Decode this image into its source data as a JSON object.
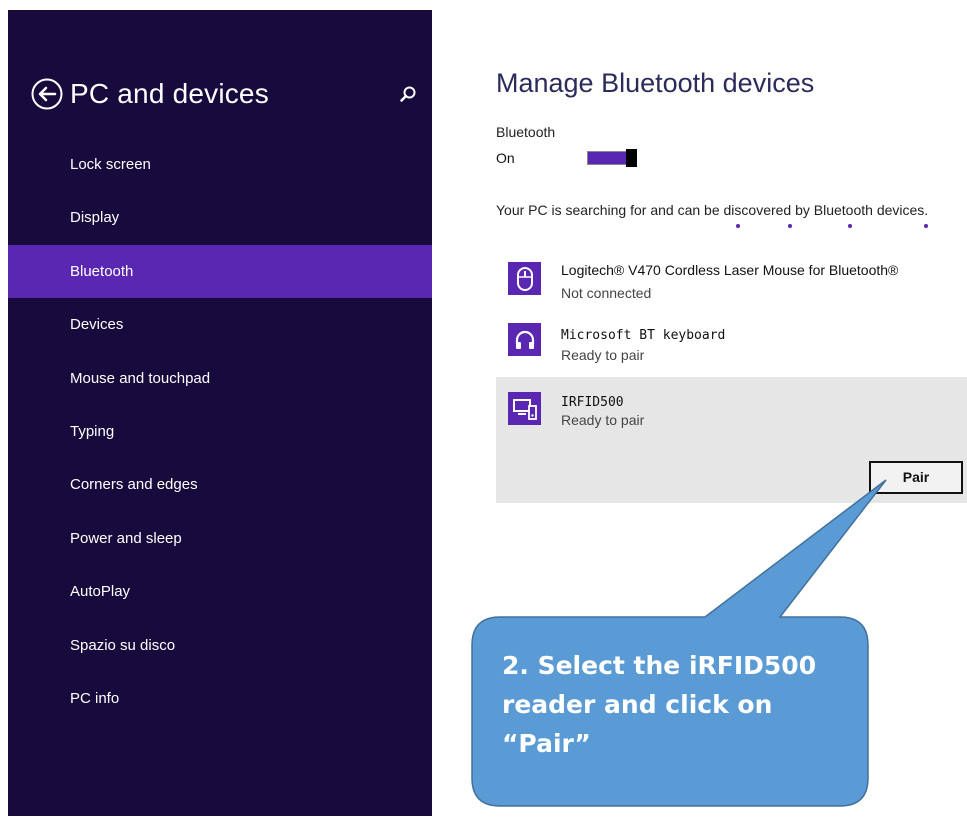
{
  "sidebar": {
    "title": "PC and devices",
    "back_icon": "back-arrow-circle-icon",
    "search_icon": "search-icon",
    "items": [
      {
        "label": "Lock screen",
        "active": false
      },
      {
        "label": "Display",
        "active": false
      },
      {
        "label": "Bluetooth",
        "active": true
      },
      {
        "label": "Devices",
        "active": false
      },
      {
        "label": "Mouse and touchpad",
        "active": false
      },
      {
        "label": "Typing",
        "active": false
      },
      {
        "label": "Corners and edges",
        "active": false
      },
      {
        "label": "Power and sleep",
        "active": false
      },
      {
        "label": "AutoPlay",
        "active": false
      },
      {
        "label": "Spazio su disco",
        "active": false
      },
      {
        "label": "PC info",
        "active": false
      }
    ]
  },
  "main": {
    "title": "Manage Bluetooth devices",
    "bluetooth_label": "Bluetooth",
    "bluetooth_state": "On",
    "toggle_on": true,
    "search_status": "Your PC is searching for and can be discovered by Bluetooth devices.",
    "devices": [
      {
        "name": "Logitech® V470 Cordless Laser Mouse for Bluetooth®",
        "status": "Not connected",
        "icon": "mouse-icon",
        "selected": false
      },
      {
        "name": "Microsoft BT keyboard",
        "status": "Ready to pair",
        "icon": "headset-icon",
        "selected": false
      },
      {
        "name": "IRFID500",
        "status": "Ready to pair",
        "icon": "device-icon",
        "selected": true
      }
    ],
    "pair_label": "Pair"
  },
  "callout": {
    "text": "2. Select the iRFID500 reader and click on “Pair”"
  },
  "colors": {
    "sidebar_bg": "#180a3c",
    "accent": "#5a27b3",
    "selected_bg": "#e6e6e6",
    "callout_fill": "#5b9bd5",
    "callout_stroke": "#41719c"
  }
}
